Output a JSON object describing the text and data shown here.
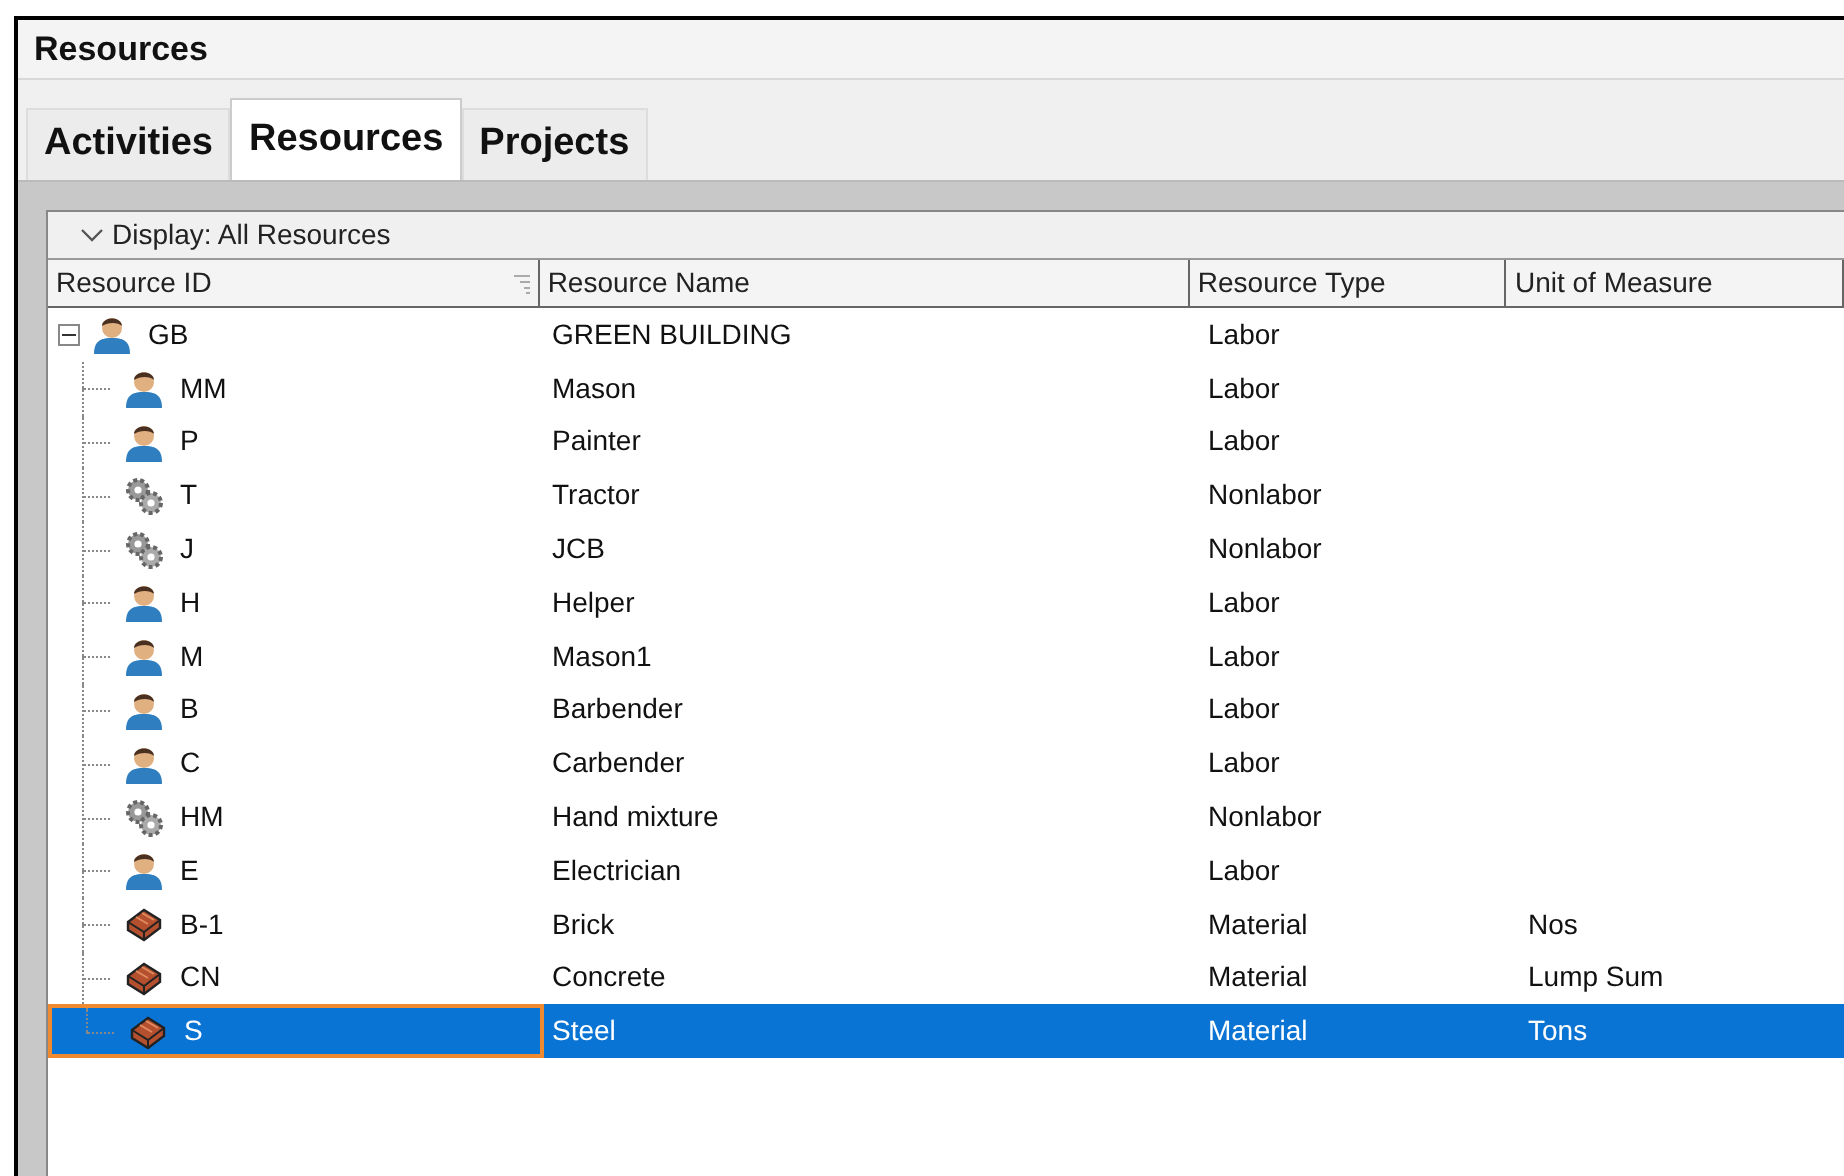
{
  "window": {
    "title": "Resources"
  },
  "tabs": [
    {
      "label": "Activities",
      "selected": false
    },
    {
      "label": "Resources",
      "selected": true
    },
    {
      "label": "Projects",
      "selected": false
    }
  ],
  "display_bar": {
    "label": "Display: All Resources",
    "expanded": true
  },
  "table": {
    "columns": [
      "Resource ID",
      "Resource Name",
      "Resource Type",
      "Unit of Measure"
    ],
    "rows": [
      {
        "kind": "labor",
        "id": "GB",
        "name": "GREEN BUILDING",
        "type": "Labor",
        "selected": false,
        "expanded": true,
        "children": [
          {
            "kind": "labor",
            "id": "MM",
            "name": "Mason",
            "type": "Labor",
            "selected": false
          },
          {
            "kind": "labor",
            "id": "P",
            "name": "Painter",
            "type": "Labor",
            "selected": false
          },
          {
            "kind": "nonlabor",
            "id": "T",
            "name": "Tractor",
            "type": "Nonlabor",
            "selected": false
          },
          {
            "kind": "nonlabor",
            "id": "J",
            "name": "JCB",
            "type": "Nonlabor",
            "selected": false
          },
          {
            "kind": "labor",
            "id": "H",
            "name": "Helper",
            "type": "Labor",
            "selected": false
          },
          {
            "kind": "labor",
            "id": "M",
            "name": "Mason1",
            "type": "Labor",
            "selected": false
          },
          {
            "kind": "labor",
            "id": "B",
            "name": "Barbender",
            "type": "Labor",
            "selected": false
          },
          {
            "kind": "labor",
            "id": "C",
            "name": "Carbender",
            "type": "Labor",
            "selected": false
          },
          {
            "kind": "nonlabor",
            "id": "HM",
            "name": "Hand mixture",
            "type": "Nonlabor",
            "selected": false
          },
          {
            "kind": "labor",
            "id": "E",
            "name": "Electrician",
            "type": "Labor",
            "selected": false
          },
          {
            "kind": "material",
            "id": "B-1",
            "name": "Brick",
            "type": "Material",
            "unit": "Nos",
            "selected": false
          },
          {
            "kind": "material",
            "id": "CN",
            "name": "Concrete",
            "type": "Material",
            "unit": "Lump Sum",
            "selected": false
          },
          {
            "kind": "material",
            "id": "S",
            "name": "Steel",
            "type": "Material",
            "unit": "Tons",
            "selected": true
          }
        ]
      }
    ]
  }
}
